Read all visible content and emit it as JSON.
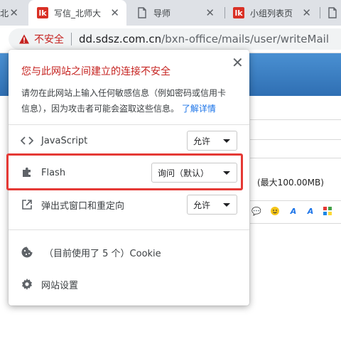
{
  "tabs": [
    {
      "label": "北",
      "favicon": "bk-icon",
      "active": false
    },
    {
      "label": "写信_北师大",
      "favicon": "bk-icon",
      "active": true
    },
    {
      "label": "导师",
      "favicon": "doc-icon",
      "active": false
    },
    {
      "label": "小组列表页",
      "favicon": "bk-icon",
      "active": false
    },
    {
      "label": "",
      "favicon": "doc-icon",
      "active": false
    }
  ],
  "address_bar": {
    "security_label": "不安全",
    "url_host": "dd.sdsz.com.cn",
    "url_path": "/bxn-office/mails/user/writeMail"
  },
  "background_page": {
    "size_note": "(最大100.00MB)"
  },
  "popup": {
    "title": "您与此网站之间建立的连接不安全",
    "desc_line1": "请勿在此网站上输入任何敏感信息（例如密码或信用卡",
    "desc_line2": "信息），因为攻击者可能会盗取这些信息。",
    "learn_more": "了解详情",
    "permissions": [
      {
        "label": "JavaScript",
        "icon": "code-icon",
        "value": "允许"
      },
      {
        "label": "Flash",
        "icon": "puzzle-icon",
        "value": "询问（默认）"
      },
      {
        "label": "弹出式窗口和重定向",
        "icon": "popup-icon",
        "value": "允许"
      }
    ],
    "cookie_label": "（目前使用了 5 个）Cookie",
    "site_settings_label": "网站设置"
  },
  "colors": {
    "warning_red": "#c5221f",
    "link_blue": "#1a73e8",
    "highlight_red": "#e53935",
    "header_blue": "#3a7cc2"
  }
}
